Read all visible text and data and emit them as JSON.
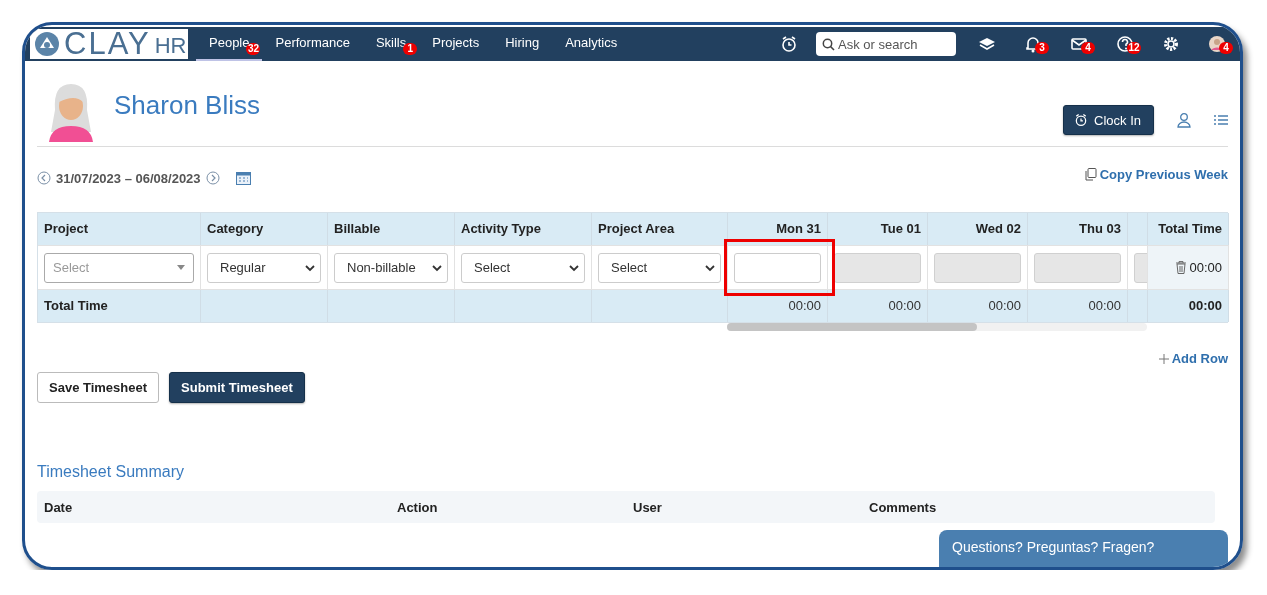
{
  "nav": {
    "logo": {
      "word": "CLAY",
      "suffix": "HR"
    },
    "links": [
      {
        "label": "People",
        "selected": true,
        "badge": "32"
      },
      {
        "label": "Performance",
        "selected": false
      },
      {
        "label": "Skills",
        "selected": false,
        "badge": "1"
      },
      {
        "label": "Projects",
        "selected": false
      },
      {
        "label": "Hiring",
        "selected": false
      },
      {
        "label": "Analytics",
        "selected": false
      }
    ],
    "tools": [
      {
        "kind": "alarm"
      },
      {
        "kind": "search",
        "placeholder": "Ask or search"
      },
      {
        "kind": "layers"
      },
      {
        "kind": "bell",
        "badge": "3"
      },
      {
        "kind": "mail",
        "badge": "4"
      },
      {
        "kind": "help",
        "badge": "12"
      },
      {
        "kind": "gear"
      },
      {
        "kind": "avatar",
        "badge": "4"
      }
    ]
  },
  "header": {
    "name": "Sharon Bliss",
    "clock_button": "Clock In"
  },
  "week": {
    "range": "31/07/2023 – 06/08/2023",
    "copy_link": "Copy Previous Week"
  },
  "table": {
    "columns": [
      {
        "label": "Project",
        "kind": "text"
      },
      {
        "label": "Category",
        "kind": "text"
      },
      {
        "label": "Billable",
        "kind": "text"
      },
      {
        "label": "Activity Type",
        "kind": "text"
      },
      {
        "label": "Project Area",
        "kind": "text"
      },
      {
        "label": "Mon 31",
        "kind": "day"
      },
      {
        "label": "Tue 01",
        "kind": "day"
      },
      {
        "label": "Wed 02",
        "kind": "day"
      },
      {
        "label": "Thu 03",
        "kind": "day"
      },
      {
        "kind": "cut"
      },
      {
        "label": "Total Time",
        "kind": "total"
      }
    ],
    "rows": [
      [
        {
          "kind": "combo",
          "placeholder": "Select"
        },
        {
          "kind": "select",
          "value": "Regular"
        },
        {
          "kind": "select",
          "value": "Non-billable"
        },
        {
          "kind": "select",
          "value": "Select"
        },
        {
          "kind": "select",
          "value": "Select"
        },
        {
          "kind": "time",
          "disabled": false,
          "highlighted": true
        },
        {
          "kind": "time",
          "disabled": true,
          "highlighted": false
        },
        {
          "kind": "time",
          "disabled": true,
          "highlighted": false
        },
        {
          "kind": "time",
          "disabled": true,
          "highlighted": false
        },
        {
          "kind": "time",
          "disabled": true,
          "highlighted": false
        },
        {
          "kind": "total",
          "value": "00:00"
        }
      ]
    ],
    "totals": [
      {
        "kind": "label",
        "text": "Total Time"
      },
      {
        "kind": "blank"
      },
      {
        "kind": "blank"
      },
      {
        "kind": "blank"
      },
      {
        "kind": "blank"
      },
      {
        "kind": "time",
        "text": "00:00"
      },
      {
        "kind": "time",
        "text": "00:00"
      },
      {
        "kind": "time",
        "text": "00:00"
      },
      {
        "kind": "time",
        "text": "00:00"
      },
      {
        "kind": "blank"
      },
      {
        "kind": "grand",
        "text": "00:00"
      }
    ]
  },
  "add_row": "Add Row",
  "buttons": [
    {
      "label": "Save Timesheet",
      "kind": "secondary"
    },
    {
      "label": "Submit Timesheet",
      "kind": "primary"
    }
  ],
  "summary": {
    "title": "Timesheet Summary",
    "columns": [
      "Date",
      "Action",
      "User",
      "Comments"
    ]
  },
  "chat_tab": "Questions? Preguntas? Fragen?"
}
